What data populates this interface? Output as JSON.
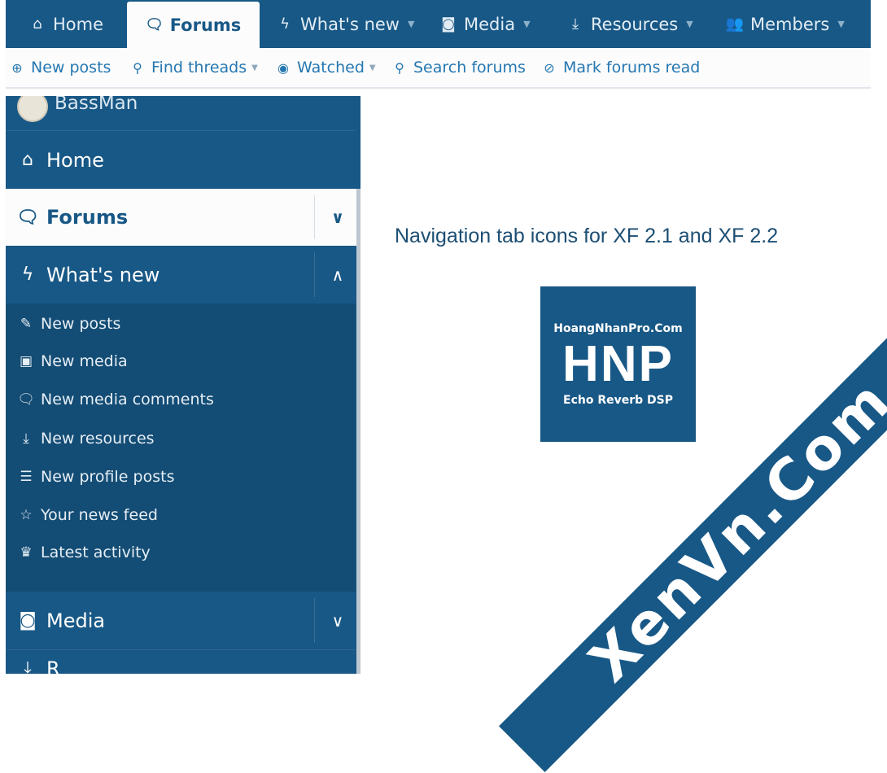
{
  "topnav": {
    "tabs": [
      {
        "label": "Home",
        "icon": "home-icon"
      },
      {
        "label": "Forums",
        "icon": "comments-icon",
        "active": true
      },
      {
        "label": "What's new",
        "icon": "bolt-icon"
      },
      {
        "label": "Media",
        "icon": "camera-icon"
      },
      {
        "label": "Resources",
        "icon": "download-box-icon"
      },
      {
        "label": "Members",
        "icon": "users-icon"
      }
    ]
  },
  "subnav": {
    "items": [
      {
        "label": "New posts",
        "icon": "search-plus-icon"
      },
      {
        "label": "Find threads",
        "icon": "search-icon"
      },
      {
        "label": "Watched",
        "icon": "eye-icon"
      },
      {
        "label": "Search forums",
        "icon": "search-icon"
      },
      {
        "label": "Mark forums read",
        "icon": "eye-slash-icon"
      }
    ]
  },
  "sidebar": {
    "user": "BassMan",
    "home": "Home",
    "forums": "Forums",
    "whats_new": "What's new",
    "whats_new_items": [
      {
        "label": "New posts",
        "icon": "pencil-icon"
      },
      {
        "label": "New media",
        "icon": "images-icon"
      },
      {
        "label": "New media comments",
        "icon": "comments-icon"
      },
      {
        "label": "New resources",
        "icon": "download-box-icon"
      },
      {
        "label": "New profile posts",
        "icon": "rss-icon"
      },
      {
        "label": "Your news feed",
        "icon": "star-icon"
      },
      {
        "label": "Latest activity",
        "icon": "trophy-icon"
      }
    ],
    "media": "Media",
    "resources": "R"
  },
  "content": {
    "headline": "Navigation tab icons for XF 2.1 and XF 2.2",
    "logo": {
      "top": "HoangNhanPro.Com",
      "big": "HNP",
      "bottom": "Echo Reverb DSP"
    },
    "watermark": "XenVn.Com"
  },
  "colors": {
    "nav_blue": "#185886",
    "nav_dark": "#134c74",
    "link": "#2577b1"
  }
}
